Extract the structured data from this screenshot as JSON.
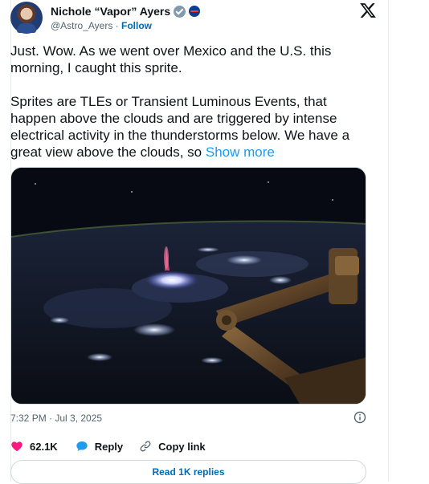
{
  "author": {
    "display_name": "Nichole “Vapor” Ayers",
    "handle": "@Astro_Ayers",
    "separator": " · ",
    "follow_label": "Follow"
  },
  "tweet": {
    "paragraph_1": "Just. Wow. As we went over Mexico and the U.S. this morning, I caught this sprite.",
    "paragraph_2": "Sprites are TLEs or Transient Luminous Events, that happen above the clouds and are triggered by intense electrical activity in the thunderstorms below. We have a great view above the clouds, so ",
    "show_more_label": "Show more",
    "timestamp": "7:32 PM · Jul 3, 2025"
  },
  "actions": {
    "likes_count": "62.1K",
    "reply_label": "Reply",
    "copy_link_label": "Copy link",
    "read_replies_label": "Read 1K replies"
  },
  "icons": {
    "brand_logo": "x-logo-icon",
    "verified": "verified-badge-icon",
    "affiliation": "nasa-affiliation-icon",
    "info": "info-icon",
    "like": "heart-icon",
    "reply": "speech-bubble-icon",
    "copy": "link-icon"
  },
  "colors": {
    "like": "#f91880",
    "reply": "#1d9bf0",
    "link": "#1d9bf0",
    "follow": "#0069b3",
    "muted": "#536471"
  }
}
